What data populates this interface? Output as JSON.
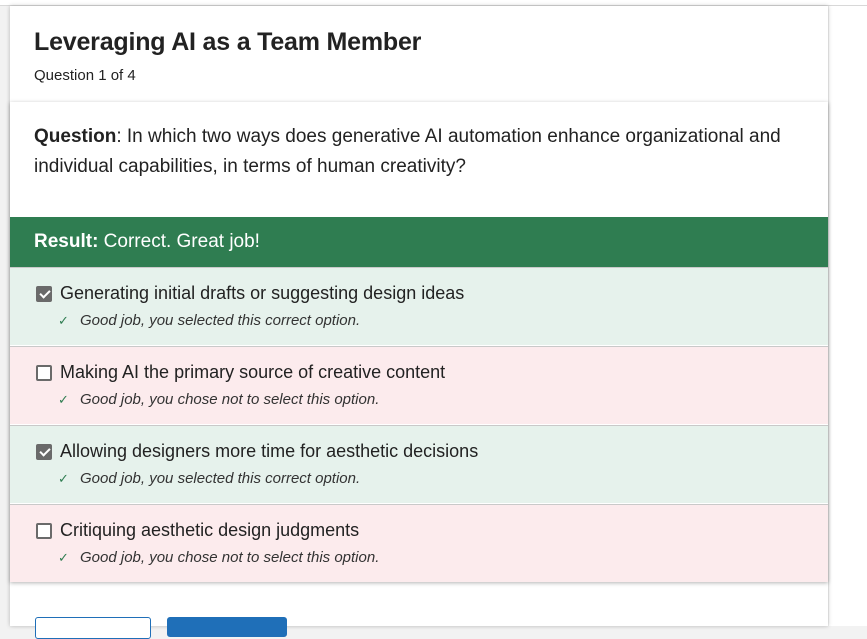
{
  "quiz": {
    "title": "Leveraging AI as a Team Member",
    "progress": "Question 1 of 4",
    "question_label": "Question",
    "question_text": ": In which two ways does generative AI automation enhance organizational and individual capabilities, in terms of human creativity?",
    "result_label": "Result:",
    "result_text": " Correct. Great job!",
    "options": [
      {
        "label": "Generating initial drafts or suggesting design ideas",
        "checked": true,
        "status": "correct",
        "feedback": "Good job, you selected this correct option."
      },
      {
        "label": "Making AI the primary source of creative content",
        "checked": false,
        "status": "incorrect",
        "feedback": "Good job, you chose not to select this option."
      },
      {
        "label": "Allowing designers more time for aesthetic decisions",
        "checked": true,
        "status": "correct",
        "feedback": "Good job, you selected this correct option."
      },
      {
        "label": "Critiquing aesthetic design judgments",
        "checked": false,
        "status": "incorrect",
        "feedback": "Good job, you chose not to select this option."
      }
    ],
    "feedback_icon": "checkmark-icon"
  },
  "colors": {
    "result_green": "#2f7d51",
    "correct_bg": "#e6f2ec",
    "incorrect_bg": "#fcebed",
    "primary_blue": "#1f6fb8"
  }
}
